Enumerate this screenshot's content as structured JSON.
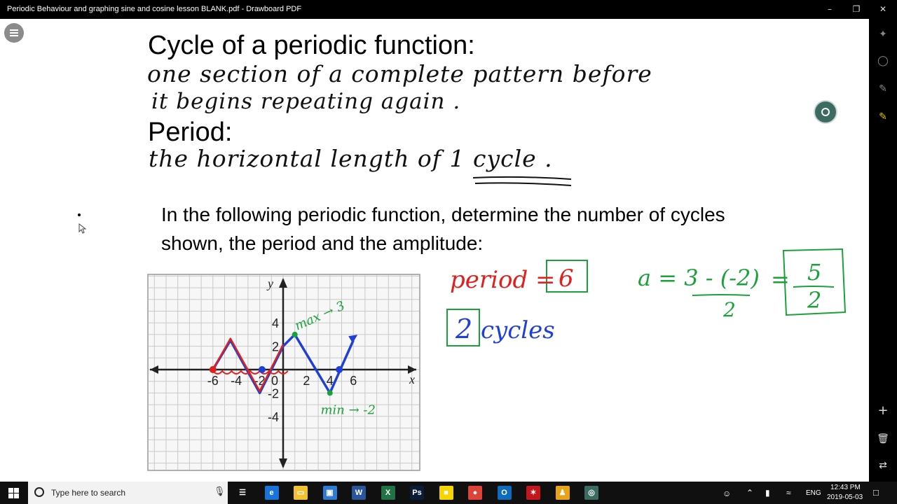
{
  "window": {
    "title": "Periodic Behaviour  and graphing sine and cosine lesson BLANK.pdf - Drawboard PDF",
    "minimize": "–",
    "restore": "❐",
    "close": "✕"
  },
  "page": {
    "heading_cycle": "Cycle of a periodic function:",
    "cycle_def_line1": "one section of a complete pattern before",
    "cycle_def_line2": "it begins repeating again .",
    "heading_period": "Period:",
    "period_def": "the horizontal length of 1 cycle .",
    "instruction": "In the following periodic function, determine the number of cycles shown, the period and the amplitude:"
  },
  "graph": {
    "x_tick_labels": [
      "-6",
      "-4",
      "-2",
      "0",
      "2",
      "4",
      "6"
    ],
    "y_tick_labels": [
      "4",
      "2",
      "-2",
      "-4"
    ],
    "x_axis_label": "x",
    "y_axis_label": "y",
    "max_note": "max → 3",
    "min_note": "min → -2",
    "curve_points": [
      [
        -6,
        0
      ],
      [
        -4.5,
        2.5
      ],
      [
        -2,
        -2
      ],
      [
        0,
        2
      ],
      [
        1,
        3
      ],
      [
        4,
        -2
      ],
      [
        6,
        2.5
      ]
    ]
  },
  "notes": {
    "period_label": "period =",
    "period_value": "6",
    "cycles_value": "2",
    "cycles_label": "cycles",
    "amp_lhs": "a = 3 - (-2)",
    "amp_den": "2",
    "amp_eq": "=",
    "amp_num": "5",
    "amp_den2": "2"
  },
  "taskbar": {
    "search_placeholder": "Type here to search",
    "language": "ENG",
    "time": "12:43 PM",
    "date": "2019-05-03",
    "apps": [
      "task-view-icon",
      "edge-icon",
      "file-explorer-icon",
      "store-icon",
      "word-icon",
      "excel-icon",
      "photoshop-icon",
      "sticky-notes-icon",
      "chrome-icon",
      "outlook-icon",
      "acrobat-icon",
      "classroom-icon",
      "drawboard-icon"
    ]
  },
  "colors": {
    "red": "#e0201c",
    "blue": "#1f3fd9",
    "green": "#1aa23a"
  }
}
